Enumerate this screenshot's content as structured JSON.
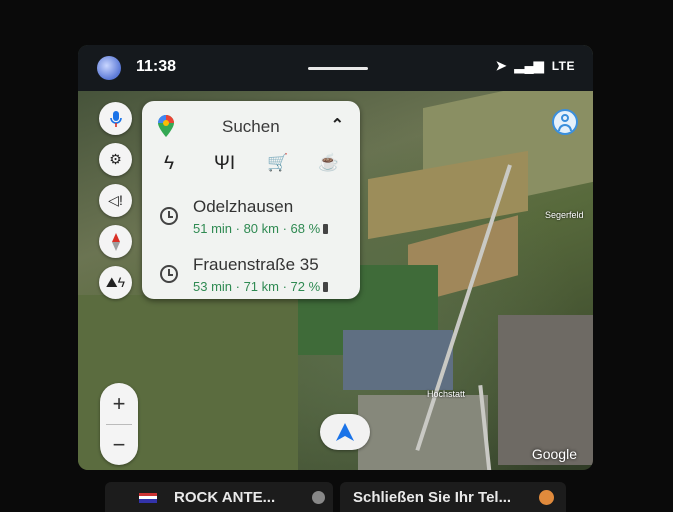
{
  "status": {
    "time": "11:38",
    "network": "LTE"
  },
  "search": {
    "label": "Suchen",
    "categories": [
      {
        "icon": "charging-station-icon",
        "glyph": "ϟ"
      },
      {
        "icon": "restaurant-icon",
        "glyph": "ΨI"
      },
      {
        "icon": "shopping-cart-icon",
        "glyph": "🛒"
      },
      {
        "icon": "coffee-icon",
        "glyph": "☕"
      }
    ]
  },
  "destinations": [
    {
      "name": "Odelzhausen",
      "info": "51 min · 80 km · 68 %"
    },
    {
      "name": "Frauenstraße 35",
      "info": "53 min · 71 km · 72 %"
    }
  ],
  "zoom": {
    "in": "+",
    "out": "−"
  },
  "map": {
    "labels": [
      "Hochstatt",
      "Segerfeld"
    ],
    "attribution": "Google"
  },
  "bottom": {
    "media_title": "ROCK ANTE...",
    "notification": "Schließen Sie Ihr Tel..."
  },
  "colors": {
    "accent": "#3b8fdc",
    "eta": "#2f8a52"
  }
}
